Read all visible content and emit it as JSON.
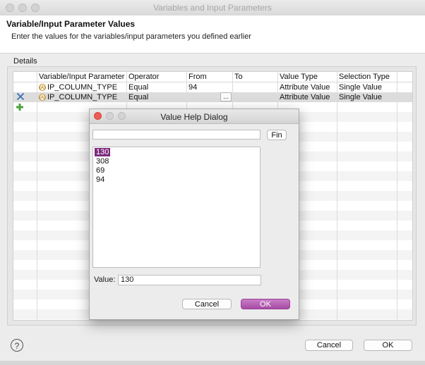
{
  "window": {
    "title": "Variables and Input Parameters"
  },
  "header": {
    "title": "Variable/Input Parameter Values",
    "description": "Enter the values for the variables/input parameters you defined earlier"
  },
  "details": {
    "label": "Details"
  },
  "table": {
    "columns": [
      "Variable/Input Parameter",
      "Operator",
      "From",
      "To",
      "Value Type",
      "Selection Type"
    ],
    "rows": [
      {
        "parameter": "IP_COLUMN_TYPE",
        "operator": "Equal",
        "from": "94",
        "to": "",
        "value_type": "Attribute Value",
        "selection_type": "Single Value"
      },
      {
        "parameter": "IP_COLUMN_TYPE",
        "operator": "Equal",
        "from": "",
        "to": "",
        "value_type": "Attribute Value",
        "selection_type": "Single Value"
      }
    ],
    "ellipsis_label": "..."
  },
  "dialog": {
    "title": "Value Help Dialog",
    "find_label": "Fin",
    "search_value": "",
    "items": [
      "130",
      "308",
      "69",
      "94"
    ],
    "selected_index": 0,
    "value_label": "Value:",
    "value": "130",
    "cancel_label": "Cancel",
    "ok_label": "OK"
  },
  "footer": {
    "cancel_label": "Cancel",
    "ok_label": "OK"
  },
  "colors": {
    "accent": "#a64ba4",
    "selection": "#7d2a7c",
    "close_red": "#ee5c55"
  }
}
